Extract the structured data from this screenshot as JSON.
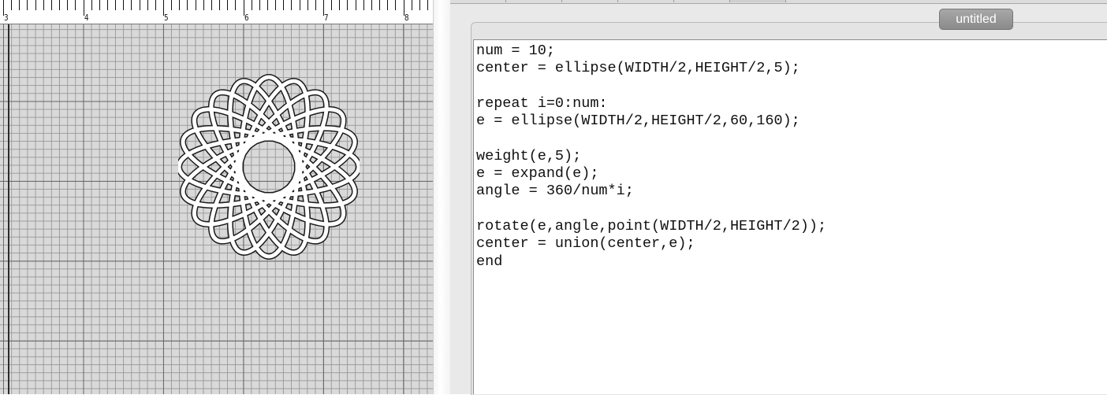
{
  "ruler": {
    "labels": [
      "3",
      "4",
      "5",
      "6",
      "7",
      "8"
    ]
  },
  "canvas": {
    "shape": "flower-of-ellipses",
    "ellipse_count": 10
  },
  "editor": {
    "title": "untitled",
    "code_lines": [
      "num = 10;",
      "center = ellipse(WIDTH/2,HEIGHT/2,5);",
      "",
      "repeat i=0:num:",
      "e = ellipse(WIDTH/2,HEIGHT/2,60,160);",
      "",
      "weight(e,5);",
      "e = expand(e);",
      "angle = 360/num*i;",
      "",
      "rotate(e,angle,point(WIDTH/2,HEIGHT/2));",
      "center = union(center,e);",
      "end"
    ]
  },
  "colors": {
    "canvas_bg": "#d9d9d9",
    "grid_major": "#6b6b6b",
    "grid_minor": "#9c9c9c",
    "title_pill": "#999999"
  }
}
